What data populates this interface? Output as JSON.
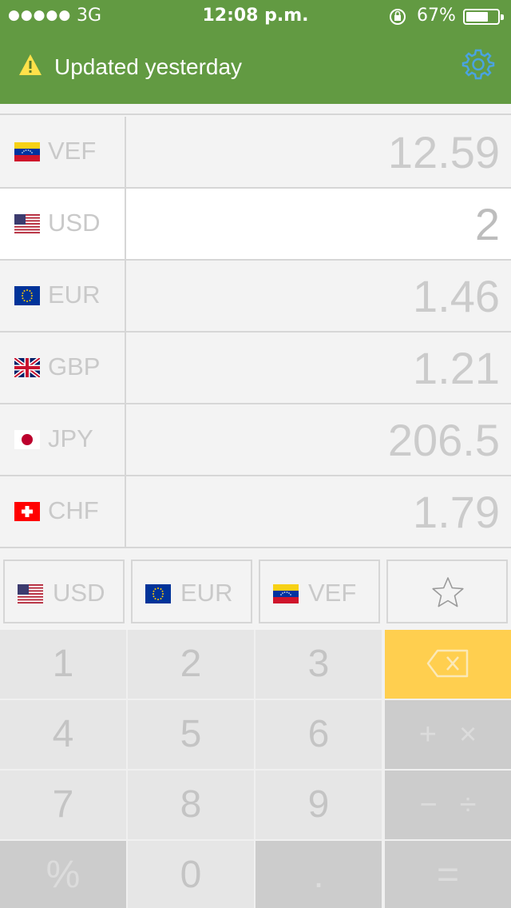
{
  "status_bar": {
    "signal": "●●●●●",
    "network": "3G",
    "time": "12:08 p.m.",
    "battery_percent": "67%",
    "battery_level": 0.67
  },
  "header": {
    "update_text": "Updated yesterday",
    "warning_icon": "warning-triangle-icon",
    "settings_icon": "gear-icon",
    "background_color": "#629a42"
  },
  "currencies": [
    {
      "code": "VEF",
      "value": "12.59",
      "flag": "venezuela-flag-icon"
    },
    {
      "code": "USD",
      "value": "2",
      "flag": "usa-flag-icon",
      "selected": true
    },
    {
      "code": "EUR",
      "value": "1.46",
      "flag": "eu-flag-icon"
    },
    {
      "code": "GBP",
      "value": "1.21",
      "flag": "uk-flag-icon"
    },
    {
      "code": "JPY",
      "value": "206.5",
      "flag": "japan-flag-icon"
    },
    {
      "code": "CHF",
      "value": "1.79",
      "flag": "switzerland-flag-icon"
    }
  ],
  "quick_buttons": [
    {
      "label": "USD",
      "flag": "usa-flag-icon"
    },
    {
      "label": "EUR",
      "flag": "eu-flag-icon"
    },
    {
      "label": "VEF",
      "flag": "venezuela-flag-icon"
    },
    {
      "icon": "star-icon"
    }
  ],
  "keypad": {
    "k1": "1",
    "k2": "2",
    "k3": "3",
    "k4": "4",
    "k5": "5",
    "k6": "6",
    "k7": "7",
    "k8": "8",
    "k9": "9",
    "percent": "%",
    "k0": "0",
    "dot": ".",
    "plus_times": "+×",
    "minus_divide": "−÷",
    "equals": "=",
    "backspace_icon": "backspace-icon",
    "backspace_color": "#ffcf4f"
  }
}
